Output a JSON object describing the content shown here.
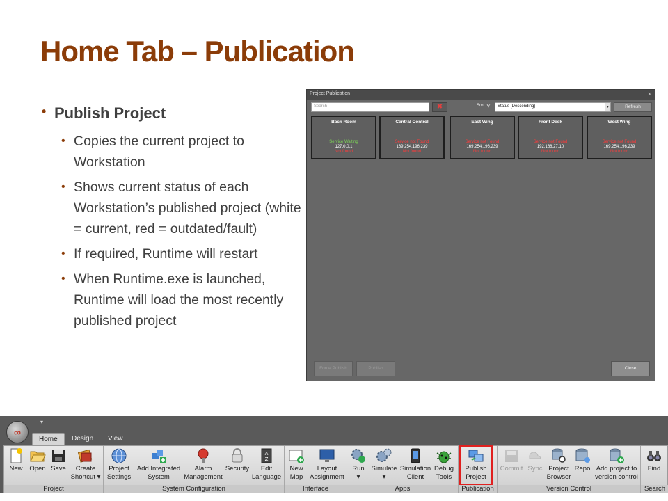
{
  "slide": {
    "title": "Home Tab – Publication",
    "bullets": {
      "main": "Publish Project",
      "sub": [
        "Copies the current project to Workstation",
        "Shows current status of each Workstation’s published project (white = current, red = outdated/fault)",
        "If required, Runtime will restart",
        "When Runtime.exe is launched, Runtime will load the most recently published project"
      ]
    }
  },
  "dialog": {
    "title": "Project Publication",
    "close": "×",
    "search_placeholder": "Search",
    "clear": "✖",
    "sort_label": "Sort by:",
    "sort_value": "Status (Descending)",
    "sort_caret": "▾",
    "refresh": "Refresh",
    "workstations": [
      {
        "name": "Back Room",
        "status": "Service Waiting",
        "ip": "127.0.0.1",
        "found": "Not found",
        "status_color": "green"
      },
      {
        "name": "Central Control",
        "status": "Service not Found",
        "ip": "169.254.196.239",
        "found": "Not found",
        "status_color": "red"
      },
      {
        "name": "East Wing",
        "status": "Service not Found",
        "ip": "169.254.196.239",
        "found": "Not found",
        "status_color": "red"
      },
      {
        "name": "Front Desk",
        "status": "Service not Found",
        "ip": "192.168.27.10",
        "found": "Not found",
        "status_color": "red"
      },
      {
        "name": "West Wing",
        "status": "Service not Found",
        "ip": "169.254.196.239",
        "found": "Not found",
        "status_color": "red"
      }
    ],
    "force_publish": "Force Publish",
    "publish": "Publish",
    "close_button": "Close"
  },
  "ribbon": {
    "tabs": [
      "Home",
      "Design",
      "View"
    ],
    "groups": {
      "project": "Project",
      "system_configuration": "System Configuration",
      "interface": "Interface",
      "apps": "Apps",
      "publication": "Publication",
      "version_control": "Version Control",
      "search": "Search"
    },
    "buttons": {
      "new": "New",
      "open": "Open",
      "save": "Save",
      "create_shortcut": [
        "Create",
        "Shortcut ▾"
      ],
      "project_settings": [
        "Project",
        "Settings"
      ],
      "add_integrated_system": [
        "Add Integrated",
        "System"
      ],
      "alarm_management": [
        "Alarm",
        "Management"
      ],
      "security": "Security",
      "edit_language": [
        "Edit",
        "Language"
      ],
      "new_map": [
        "New",
        "Map"
      ],
      "layout_assignment": [
        "Layout",
        "Assignment"
      ],
      "run": [
        "Run",
        "▾"
      ],
      "simulate": [
        "Simulate",
        "▾"
      ],
      "simulation_client": [
        "Simulation",
        "Client"
      ],
      "debug_tools": [
        "Debug",
        "Tools"
      ],
      "publish_project": [
        "Publish",
        "Project"
      ],
      "commit": "Commit",
      "sync": "Sync",
      "project_browser": [
        "Project",
        "Browser"
      ],
      "repo": "Repo",
      "add_project_vc": [
        "Add project to",
        "version control"
      ],
      "find": "Find"
    },
    "qat_caret": "▾"
  },
  "colors": {
    "title": "#8b3c08",
    "bullet": "#8b3c08",
    "body_text": "#404040",
    "dialog_bg": "#676767",
    "status_green": "#7ed957",
    "status_red": "#ff3b3b",
    "highlight": "#e0201f"
  }
}
